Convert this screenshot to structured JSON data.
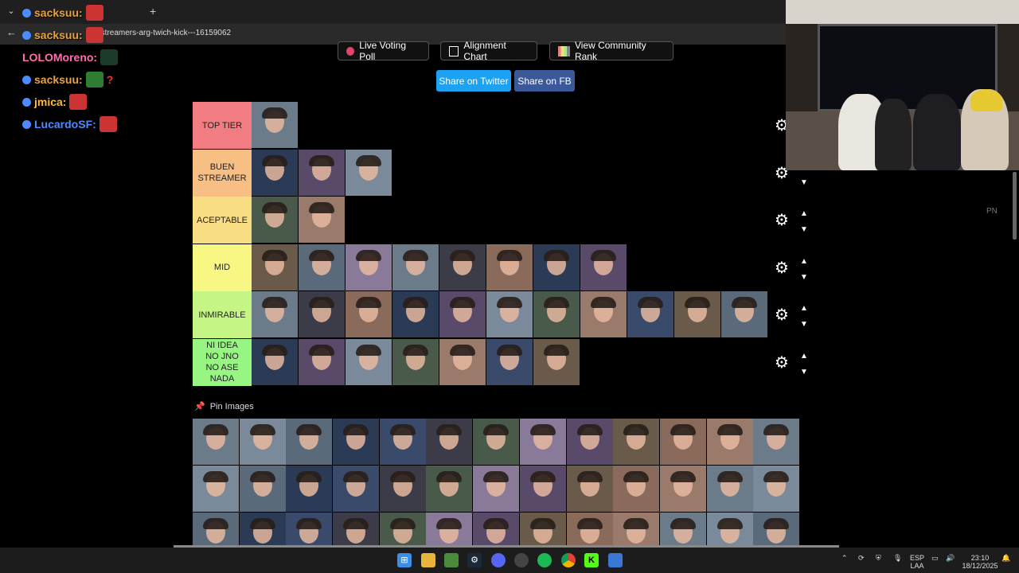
{
  "browser": {
    "tab_title": "sacksuu:",
    "url": "ate/streamers-arg-twich-kick---16159062"
  },
  "chat": [
    {
      "user": "sacksuu:",
      "color": "#e8a33a",
      "emote_color": "#c33"
    },
    {
      "user": "sacksuu:",
      "color": "#e8a33a",
      "emote_color": "#c33"
    },
    {
      "user": "LOLOMoreno:",
      "color": "#ff6fb0",
      "emote_color": "#1c3b2a"
    },
    {
      "user": "sacksuu:",
      "color": "#e8a33a",
      "emote_color": "#2e7d32",
      "extra": "?"
    },
    {
      "user": "jmica:",
      "color": "#ffb84d",
      "emote_color": "#c33"
    },
    {
      "user": "LucardoSF:",
      "color": "#4d8cff",
      "emote_color": "#c33"
    }
  ],
  "toolbar": {
    "live_voting": "Live Voting Poll",
    "alignment": "Alignment Chart",
    "community": "View Community Rank",
    "share_twitter": "Share on Twitter",
    "share_fb": "Share on FB"
  },
  "colors": {
    "share_twitter": "#1da1f2",
    "share_fb": "#3b5998"
  },
  "tiers": [
    {
      "label": "TOP TIER",
      "color": "#f17c82",
      "count": 1
    },
    {
      "label": "BUEN\nSTREAMER",
      "color": "#f7bf84",
      "count": 3
    },
    {
      "label": "ACEPTABLE",
      "color": "#f9dd82",
      "count": 2
    },
    {
      "label": "MID",
      "color": "#f9f784",
      "count": 8
    },
    {
      "label": "INMIRABLE",
      "color": "#c5f584",
      "count": 11
    },
    {
      "label": "NI IDEA\nNO JNO\nNO ASE\nNADA",
      "color": "#97f582",
      "count": 7
    }
  ],
  "pin": {
    "label": "Pin Images"
  },
  "side": {
    "pn": "PN"
  },
  "taskbar": {
    "lang1": "ESP",
    "lang2": "LAA",
    "time": "23:10",
    "date": "18/12/2025"
  }
}
